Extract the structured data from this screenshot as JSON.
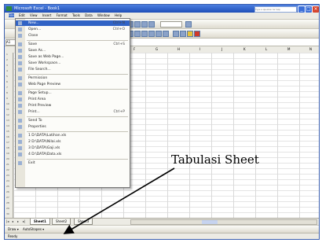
{
  "window": {
    "title": "Microsoft Excel - Book1",
    "search_placeholder": "Type a question for help",
    "minimize": "_",
    "maximize": "□",
    "close": "×"
  },
  "menubar": [
    "File",
    "Edit",
    "View",
    "Insert",
    "Format",
    "Tools",
    "Data",
    "Window",
    "Help"
  ],
  "formula_bar": {
    "name_box": "A1"
  },
  "columns": [
    "A",
    "B",
    "C",
    "D",
    "E",
    "F",
    "G",
    "H",
    "I",
    "J",
    "K",
    "L",
    "M",
    "N"
  ],
  "rows": [
    "1",
    "2",
    "3",
    "4",
    "5",
    "6",
    "7",
    "8",
    "9",
    "10",
    "11",
    "12",
    "13",
    "14",
    "15",
    "16",
    "17",
    "18",
    "19",
    "20",
    "21",
    "22",
    "23",
    "24",
    "25",
    "26",
    "27",
    "28",
    "29",
    "30"
  ],
  "file_menu": {
    "items": [
      {
        "label": "New...",
        "shortcut": "Ctrl+N"
      },
      {
        "label": "Open...",
        "shortcut": "Ctrl+O"
      },
      {
        "label": "Close",
        "shortcut": ""
      },
      {
        "label": "Save",
        "shortcut": "Ctrl+S"
      },
      {
        "label": "Save As...",
        "shortcut": ""
      },
      {
        "label": "Save as Web Page...",
        "shortcut": ""
      },
      {
        "label": "Save Workspace...",
        "shortcut": ""
      },
      {
        "label": "File Search...",
        "shortcut": ""
      },
      {
        "label": "Permission",
        "shortcut": ""
      },
      {
        "label": "Web Page Preview",
        "shortcut": ""
      },
      {
        "label": "Page Setup...",
        "shortcut": ""
      },
      {
        "label": "Print Area",
        "shortcut": ""
      },
      {
        "label": "Print Preview",
        "shortcut": ""
      },
      {
        "label": "Print...",
        "shortcut": "Ctrl+P"
      },
      {
        "label": "Send To",
        "shortcut": ""
      },
      {
        "label": "Properties",
        "shortcut": ""
      },
      {
        "label": "1 D:\\DATA\\Latihan.xls",
        "shortcut": ""
      },
      {
        "label": "2 D:\\DATA\\Nilai.xls",
        "shortcut": ""
      },
      {
        "label": "3 D:\\DATA\\Gaji.xls",
        "shortcut": ""
      },
      {
        "label": "4 D:\\DATA\\Data.xls",
        "shortcut": ""
      },
      {
        "label": "Exit",
        "shortcut": ""
      }
    ]
  },
  "sheet_tabs": [
    "Sheet1",
    "Sheet2",
    "Sheet3"
  ],
  "tab_nav": [
    "|◂",
    "◂",
    "▸",
    "▸|"
  ],
  "draw_toolbar": {
    "draw": "Draw ▾",
    "autoshapes": "AutoShapes ▾"
  },
  "status_bar": {
    "text": "Ready"
  },
  "annotation": {
    "text": "Tabulasi Sheet"
  },
  "colors": {
    "title_bar": "#1f4fb8",
    "menu_highlight": "#3163c5",
    "excel_green": "#2f8a3d"
  }
}
